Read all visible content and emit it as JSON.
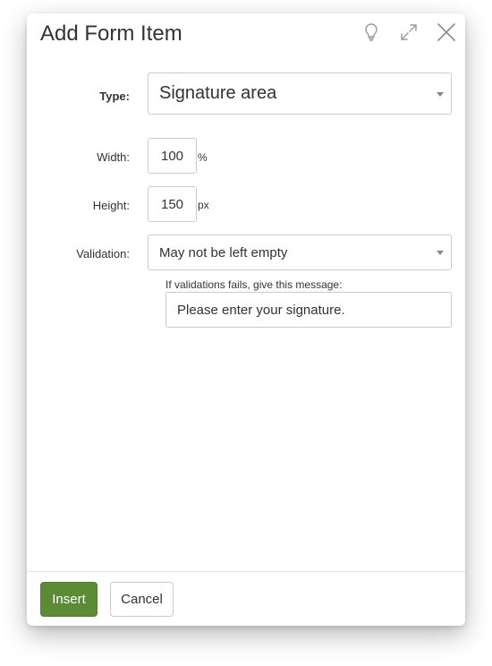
{
  "dialog": {
    "title": "Add Form Item",
    "icons": [
      "lightbulb-icon",
      "expand-icon",
      "close-icon"
    ]
  },
  "form": {
    "type_label": "Type:",
    "type_value": "Signature area",
    "width_label": "Width:",
    "width_value": "100",
    "width_unit": "%",
    "height_label": "Height:",
    "height_value": "150",
    "height_unit": "px",
    "validation_label": "Validation:",
    "validation_value": "May not be left empty",
    "message_hint": "If validations fails, give this message:",
    "message_value": "Please enter your signature."
  },
  "footer": {
    "insert_label": "Insert",
    "cancel_label": "Cancel"
  },
  "colors": {
    "primary_button": "#5b8b35",
    "border": "#cccccc",
    "text": "#333333"
  }
}
